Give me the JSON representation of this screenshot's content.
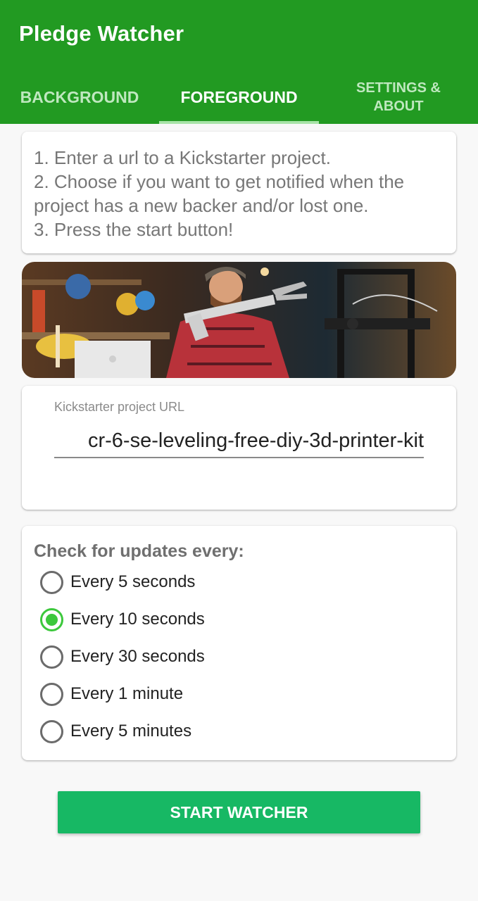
{
  "app": {
    "title": "Pledge Watcher"
  },
  "tabs": [
    {
      "label": "BACKGROUND"
    },
    {
      "label": "FOREGROUND"
    },
    {
      "label": "SETTINGS & ABOUT"
    }
  ],
  "instructions": [
    "1. Enter a url to a Kickstarter project.",
    "2. Choose if you want to get notified when the",
    "project has a new backer and/or lost one.",
    "3. Press the start button!"
  ],
  "url": {
    "label": "Kickstarter project URL",
    "value": "cr-6-se-leveling-free-diy-3d-printer-kit"
  },
  "interval": {
    "heading": "Check for updates every:",
    "options": [
      {
        "label": "Every 5 seconds"
      },
      {
        "label": "Every 10 seconds"
      },
      {
        "label": "Every 30 seconds"
      },
      {
        "label": "Every 1 minute"
      },
      {
        "label": "Every 5 minutes"
      }
    ],
    "selected": "Every 10 seconds"
  },
  "start_button": {
    "label": "START WATCHER"
  },
  "colors": {
    "app_bar": "#229a22",
    "start_button": "#17b864",
    "radio_checked": "#3cc83c"
  }
}
